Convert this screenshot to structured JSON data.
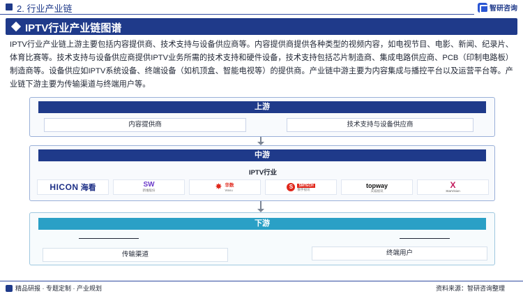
{
  "header": {
    "section_title": "2. 行业产业链",
    "brand_name": "智研咨询"
  },
  "title": "IPTV行业产业链图谱",
  "intro_text": "IPTV行业产业链上游主要包括内容提供商、技术支持与设备供应商等。内容提供商提供各种类型的视频内容，如电视节目、电影、新闻、纪录片、体育比赛等。技术支持与设备供应商提供IPTV业务所需的技术支持和硬件设备，技术支持包括芯片制造商、集成电路供应商、PCB（印制电路板）制造商等。设备供应如IPTV系统设备、终端设备（如机顶盒、智能电视等）的提供商。产业链中游主要为内容集成与播控平台以及运营平台等。产业链下游主要为传输渠道与终端用户等。",
  "upstream": {
    "label": "上游",
    "items": [
      "内容提供商",
      "技术支持与设备供应商"
    ]
  },
  "midstream": {
    "label": "中游",
    "sublabel": "IPTV行业",
    "logos": [
      {
        "name": "HICON",
        "cn": "海看"
      },
      {
        "name": "SW",
        "sub": "新维股份"
      },
      {
        "name": "华数",
        "sub": "Wasu"
      },
      {
        "name": "SMTECH",
        "s": "S",
        "sub": "数字视讯"
      },
      {
        "name": "topway",
        "sub": "天威视讯"
      },
      {
        "name": "X",
        "sub": "StarVision"
      }
    ]
  },
  "downstream": {
    "label": "下游",
    "items": [
      "传输渠道",
      "终端用户"
    ]
  },
  "footer": {
    "left": "精品研报 · 专题定制 · 产业规划",
    "source": "资料来源：智研咨询整理"
  },
  "colors": {
    "primary": "#1f3a8a",
    "downstream": "#2aa0c6"
  }
}
